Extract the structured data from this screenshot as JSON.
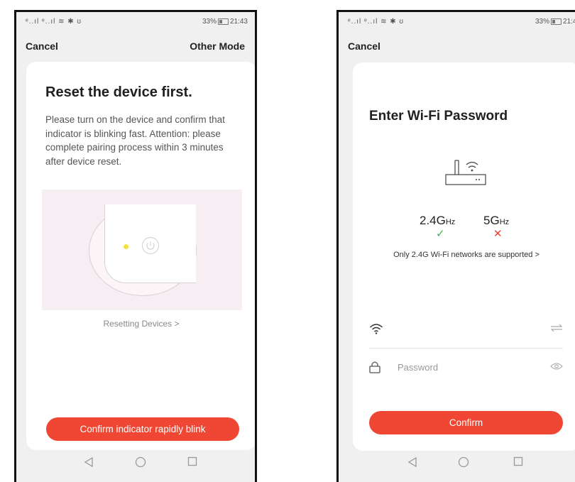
{
  "status": {
    "signal": "ᵉ..ıl ᵉ..ıl ≋ ✱ ʊ",
    "battery": "33%",
    "time": "21:43"
  },
  "left": {
    "cancel": "Cancel",
    "other_mode": "Other Mode",
    "title": "Reset the device first.",
    "description": "Please turn on the device and confirm that indicator is blinking fast. Attention: please complete pairing process within 3 minutes after device reset.",
    "resetting_link": "Resetting Devices",
    "chevron": ">",
    "confirm_button": "Confirm indicator rapidly blink"
  },
  "right": {
    "cancel": "Cancel",
    "title": "Enter Wi-Fi Password",
    "band_24_num": "2.4G",
    "band_24_unit": "Hz",
    "band_5_num": "5G",
    "band_5_unit": "Hz",
    "check": "✓",
    "cross": "✕",
    "note": "Only 2.4G Wi-Fi networks are supported",
    "chevron": ">",
    "password_placeholder": "Password",
    "confirm_button": "Confirm"
  },
  "colors": {
    "accent": "#ef4733",
    "ok": "#3bb54a",
    "bad": "#e8413c",
    "led": "#f2e43a"
  }
}
